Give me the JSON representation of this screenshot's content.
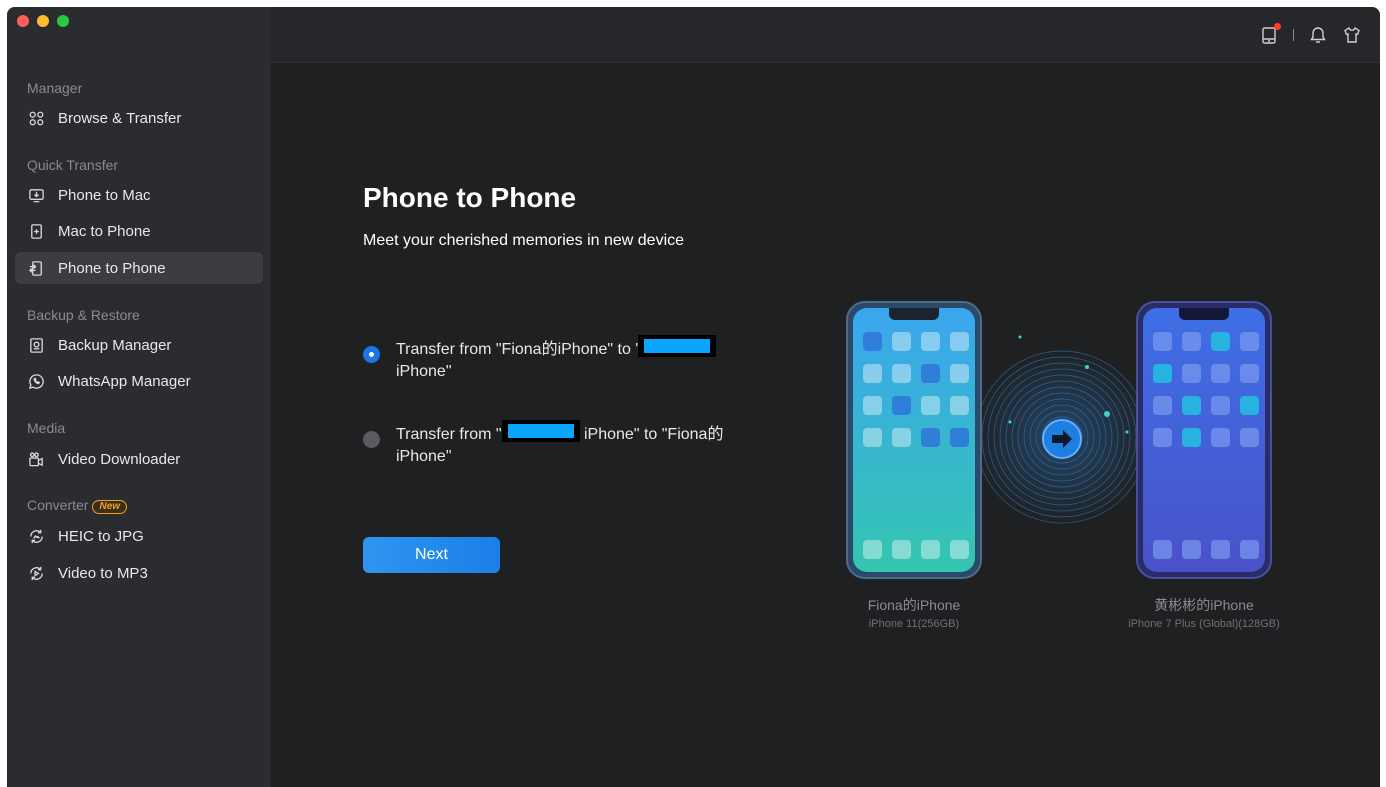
{
  "sidebar": {
    "sections": {
      "manager": "Manager",
      "quick_transfer": "Quick Transfer",
      "backup_restore": "Backup & Restore",
      "media": "Media",
      "converter": "Converter",
      "converter_badge": "New"
    },
    "items": {
      "browse_transfer": "Browse & Transfer",
      "phone_to_mac": "Phone to Mac",
      "mac_to_phone": "Mac to Phone",
      "phone_to_phone": "Phone to Phone",
      "backup_manager": "Backup Manager",
      "whatsapp_manager": "WhatsApp Manager",
      "video_downloader": "Video Downloader",
      "heic_to_jpg": "HEIC to JPG",
      "video_to_mp3": "Video to MP3"
    },
    "active_item": "Phone to Phone"
  },
  "topbar": {
    "icons": [
      "device-icon",
      "bell-icon",
      "shirt-icon"
    ]
  },
  "main": {
    "title": "Phone to Phone",
    "subtitle": "Meet your cherished memories in new device",
    "option1": {
      "prefix": "Transfer from \"Fiona的iPhone\" to '",
      "suffix": "iPhone\"",
      "selected": true
    },
    "option2": {
      "prefix": "Transfer from \"",
      "middle": "iPhone\" to \"Fiona的",
      "suffix": "iPhone\"",
      "selected": false
    },
    "next_label": "Next"
  },
  "devices": {
    "source": {
      "name": "Fiona的iPhone",
      "model": "iPhone 11(256GB)"
    },
    "target": {
      "name": "黄彬彬的iPhone",
      "model": "iPhone 7 Plus (Global)(128GB)"
    }
  },
  "colors": {
    "accent": "#1b74e8",
    "sidebar_bg": "#2b2c2f",
    "main_bg": "#1f2022",
    "redaction": "#0aa5ff"
  }
}
